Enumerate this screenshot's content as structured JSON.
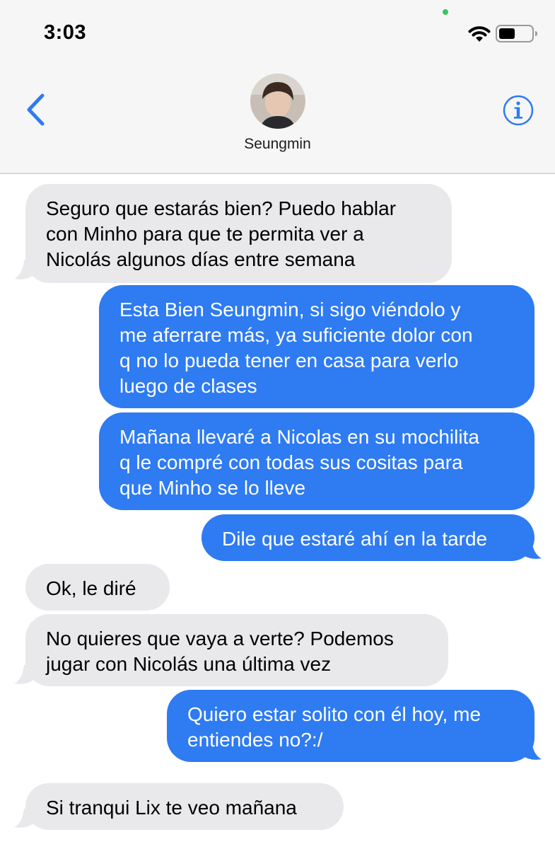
{
  "status_bar": {
    "time": "3:03",
    "dot_color": "#34c759",
    "wifi_icon": "wifi-icon",
    "battery_icon": "battery-icon"
  },
  "header": {
    "back_icon": "chevron-left-icon",
    "contact_name": "Seungmin",
    "info_icon": "info-icon",
    "accent_color": "#2e7bf2"
  },
  "colors": {
    "incoming_bubble": "#e9e9eb",
    "outgoing_bubble": "#2e7bf2",
    "header_background": "#f6f6f7"
  },
  "messages": [
    {
      "direction": "incoming",
      "lines": [
        "Seguro que estarás bien? Puedo hablar",
        "con Minho para que te permita ver a",
        "Nicolás algunos días entre semana"
      ]
    },
    {
      "direction": "outgoing",
      "lines": [
        "Esta Bien Seungmin, si sigo viéndolo y",
        "me aferrare más, ya suficiente dolor con",
        "q no lo pueda tener en casa para verlo",
        "luego de clases"
      ]
    },
    {
      "direction": "outgoing",
      "lines": [
        "Mañana llevaré a Nicolas en su mochilita",
        "q le compré con todas sus cositas para",
        "que Minho se lo lleve"
      ]
    },
    {
      "direction": "outgoing",
      "lines": [
        "Dile que estaré ahí en la tarde"
      ]
    },
    {
      "direction": "incoming",
      "lines": [
        "Ok, le diré"
      ]
    },
    {
      "direction": "incoming",
      "lines": [
        "No quieres que vaya a verte? Podemos",
        "jugar con Nicolás una última vez"
      ]
    },
    {
      "direction": "outgoing",
      "lines": [
        "Quiero estar solito con él hoy, me",
        "entiendes no?:/"
      ]
    },
    {
      "direction": "incoming",
      "lines": [
        "Si tranqui Lix te veo mañana"
      ]
    }
  ]
}
